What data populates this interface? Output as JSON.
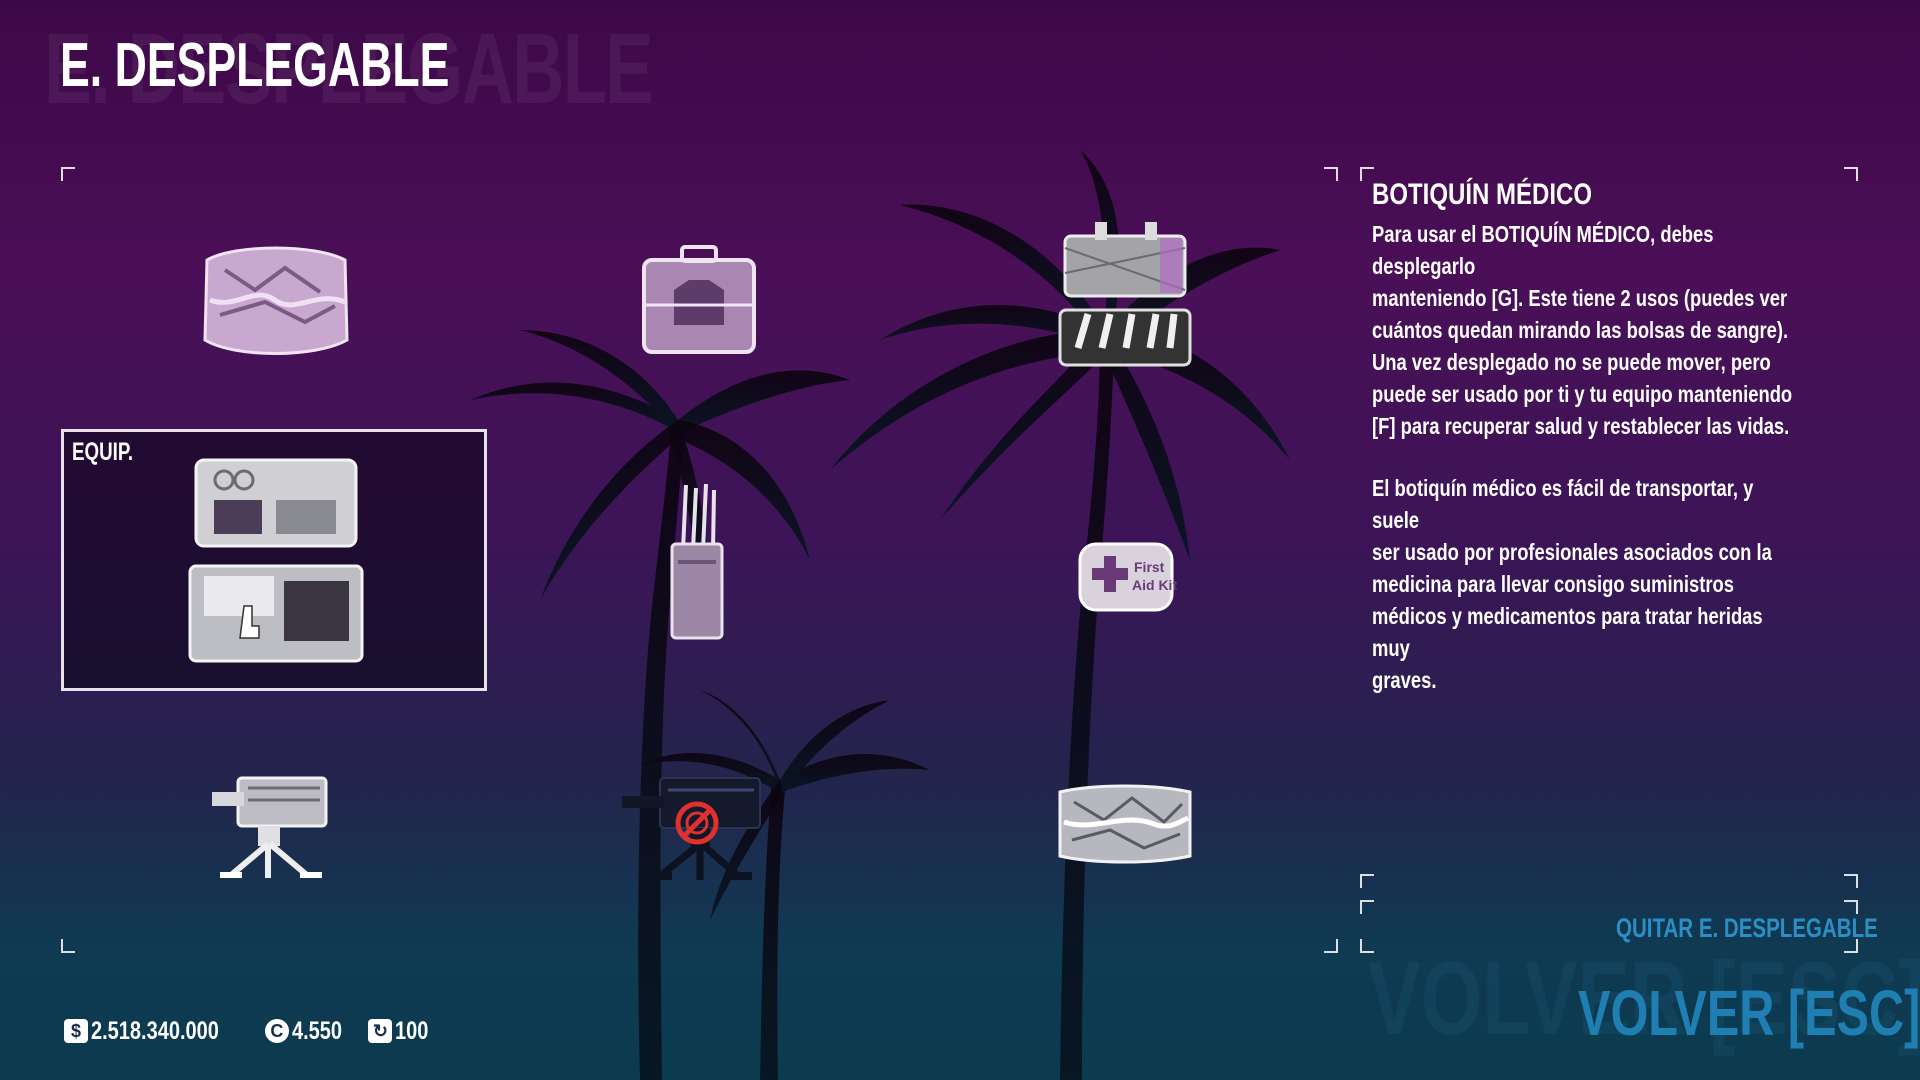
{
  "page": {
    "title": "E. DESPLEGABLE",
    "title_ghost": "E. DESPLEGABLE"
  },
  "grid": {
    "items": [
      {
        "name": "ammo-bag-icon",
        "status": "available"
      },
      {
        "name": "ecm-jammer-case-icon",
        "status": "available"
      },
      {
        "name": "doctor-bag-open-icon",
        "status": "available"
      },
      {
        "name": "trip-mines-icon",
        "status": "available"
      },
      {
        "name": "ecm-jammer-icon",
        "status": "available"
      },
      {
        "name": "first-aid-kit-icon",
        "status": "available"
      },
      {
        "name": "sentry-gun-icon",
        "status": "available"
      },
      {
        "name": "suppressed-sentry-gun-icon",
        "status": "locked"
      },
      {
        "name": "body-bag-case-icon",
        "status": "available"
      }
    ],
    "selected": {
      "badge": "EQUIP.",
      "icon": "medic-bag-icon"
    },
    "lock_icon": "no-entry-icon"
  },
  "description": {
    "title": "BOTIQUÍN MÉDICO",
    "paragraph1": "Para usar el BOTIQUÍN MÉDICO, debes desplegarlo\nmanteniendo [G]. Este tiene 2 usos (puedes ver\ncuántos quedan mirando las bolsas de sangre).\nUna vez desplegado no se puede mover, pero\npuede ser usado por ti y tu equipo manteniendo\n[F] para recuperar salud y restablecer las vidas.",
    "paragraph2": "El botiquín médico es fácil de transportar, y suele\nser usado por profesionales asociados con la\nmedicina para llevar consigo suministros\nmédicos y medicamentos para tratar heridas muy\ngraves."
  },
  "actions": {
    "remove_label": "QUITAR E. DESPLEGABLE",
    "back_label": "VOLVER [ESC]",
    "back_ghost": "VOLVER [ESC]"
  },
  "currency": {
    "money_icon": "$",
    "money": "2.518.340.000",
    "coins_icon": "C",
    "coins": "4.550",
    "level_icon": "↻",
    "level": "100"
  },
  "colors": {
    "accent_blue": "#1f7fb3",
    "lock_red": "#e0312e",
    "background_top": "#3e0848",
    "background_bottom": "#0b3b4f"
  }
}
